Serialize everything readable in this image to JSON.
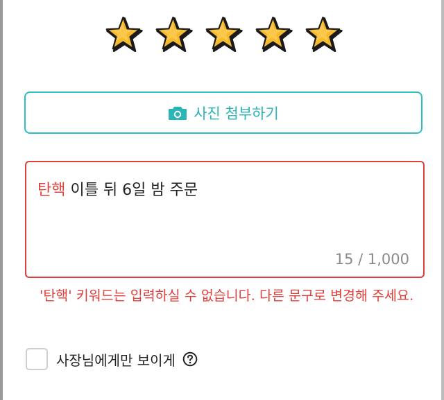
{
  "rating": {
    "max": 5,
    "value": 5,
    "star_fill": "#f6b92b",
    "star_outline": "#1a1a1a"
  },
  "photo": {
    "label": "사진 첨부하기",
    "icon": "camera-icon",
    "accent": "#2bbfc0"
  },
  "review": {
    "keyword": "탄핵",
    "text_rest": " 이틀 뒤 6일 밤 주문",
    "char_count": "15 / 1,000",
    "border_color": "#e0403c"
  },
  "error": {
    "message": "'탄핵' 키워드는 입력하실 수 없습니다. 다른 문구로 변경해 주세요.",
    "color": "#e0403c"
  },
  "owner_only": {
    "label": "사장님에게만 보이게",
    "checked": false,
    "help_icon": "question-circle-icon"
  }
}
